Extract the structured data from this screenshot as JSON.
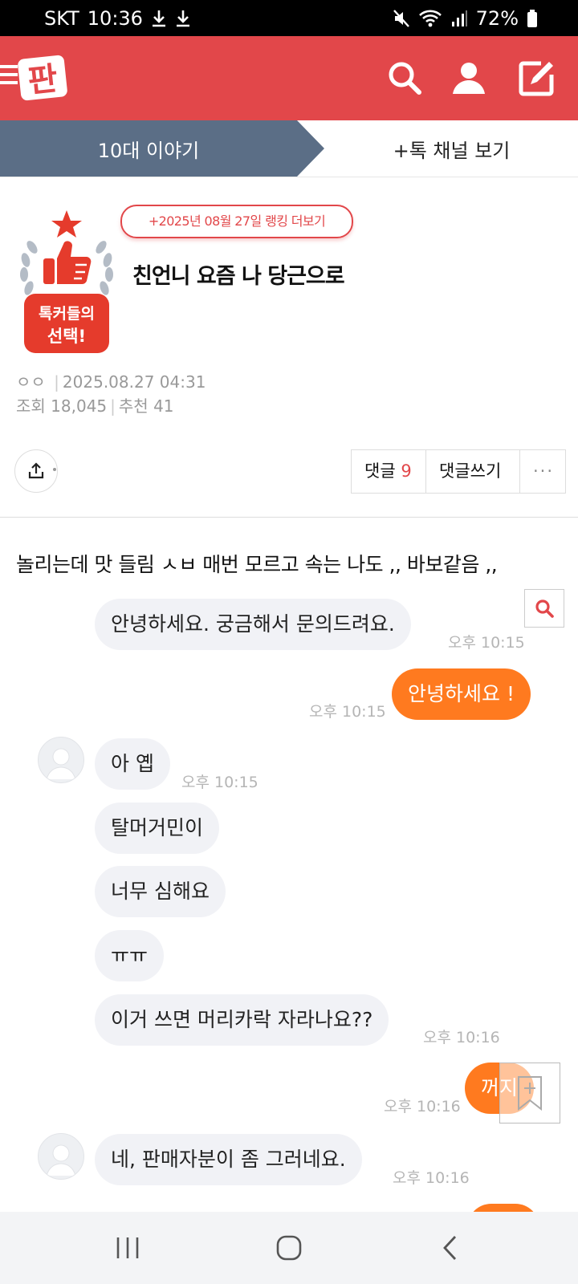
{
  "status_bar": {
    "carrier": "SKT",
    "time": "10:36",
    "battery": "72%",
    "icons": [
      "download-icon",
      "download-icon",
      "mute-icon",
      "wifi-icon",
      "signal-icon",
      "battery-icon"
    ]
  },
  "header": {
    "logo_text": "판",
    "icons": [
      "menu-icon",
      "search-icon",
      "user-icon",
      "edit-icon"
    ],
    "brand_color": "#e2474a"
  },
  "channel": {
    "tab_label": "10대 이야기",
    "more_label": "+톡 채널 보기",
    "tab_color": "#5b6e86"
  },
  "post": {
    "ranking_link": "+2025년 08월 27일 랭킹 더보기",
    "badge_text_line1": "톡커들의",
    "badge_text_line2": "선택!",
    "title": "친언니 요즘 나 당근으로",
    "author": "ㅇㅇ",
    "datetime": "2025.08.27 04:31",
    "views_label": "조회",
    "views": "18,045",
    "likes_label": "추천",
    "likes": "41",
    "comment_label": "댓글",
    "comment_count": "9",
    "write_comment_label": "댓글쓰기",
    "more_label": "···",
    "body": "놀리는데 맛 들림 ㅅㅂ 매번 모르고 속는 나도 ,, 바보같음 ,,"
  },
  "chat": {
    "messages": [
      {
        "text": "안녕하세요. 궁금해서 문의드려요.",
        "time": "오후 10:15"
      },
      {
        "text": "안녕하세요 !",
        "time": "오후 10:15"
      },
      {
        "text": "아 옙",
        "time": "오후 10:15"
      },
      {
        "text": "탈머거민이",
        "time": ""
      },
      {
        "text": "너무 심해요",
        "time": ""
      },
      {
        "text": "ㅠㅠ",
        "time": ""
      },
      {
        "text": "이거 쓰면 머리카락 자라나요??",
        "time": "오후 10:16"
      },
      {
        "text": "꺼지",
        "time": "오후 10:16"
      },
      {
        "text": "네, 판매자분이 좀 그러네요.",
        "time": "오후 10:16"
      }
    ],
    "incoming_color": "#f1f2f6",
    "outgoing_color": "#ff7a1f"
  },
  "nav": {
    "icons": [
      "recents-icon",
      "home-icon",
      "back-icon"
    ]
  }
}
